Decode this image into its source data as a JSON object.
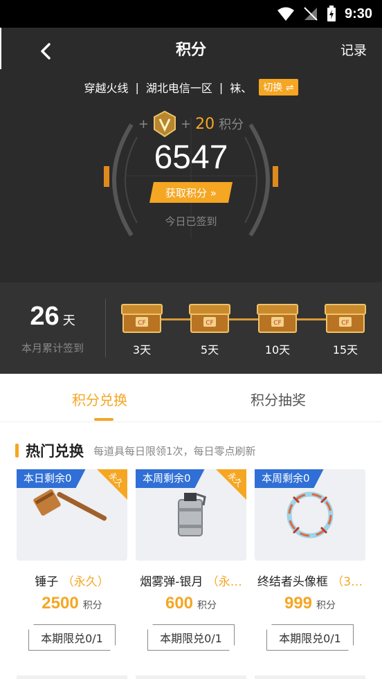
{
  "status_bar": {
    "time": "9:30"
  },
  "header": {
    "title": "积分",
    "records_label": "记录"
  },
  "account": {
    "game": "穿越火线",
    "server": "湖北电信一区",
    "role": "袜、",
    "switch_label": "切换 ⇌"
  },
  "bonus": {
    "plus1": "+",
    "plus2": "+",
    "amount": "20",
    "unit": "积分"
  },
  "points": {
    "value": "6547"
  },
  "get_points_label": "获取积分 »",
  "signed_status": "今日已签到",
  "month_sign": {
    "days": "26",
    "unit": "天",
    "label": "本月累计签到"
  },
  "chests": [
    {
      "label": "3天"
    },
    {
      "label": "5天"
    },
    {
      "label": "10天"
    },
    {
      "label": "15天"
    }
  ],
  "tabs": [
    {
      "label": "积分兑换",
      "active": true
    },
    {
      "label": "积分抽奖",
      "active": false
    }
  ],
  "section": {
    "title": "热门兑换",
    "note": "每道具每日限领1次，每日零点刷新"
  },
  "items": [
    {
      "tag": "本日剩余0",
      "corner": "永久",
      "name": "锤子",
      "duration": "（永久）",
      "price": "2500",
      "price_unit": "积分",
      "limit": "本期限兑0/1",
      "icon": "hammer-icon"
    },
    {
      "tag": "本周剩余0",
      "corner": "永久",
      "name": "烟雾弹-银月",
      "duration": "（永…",
      "price": "600",
      "price_unit": "积分",
      "limit": "本期限兑0/1",
      "icon": "smoke-grenade-icon"
    },
    {
      "tag": "本周剩余0",
      "corner": "",
      "name": "终结者头像框",
      "duration": "（3…",
      "price": "999",
      "price_unit": "积分",
      "limit": "本期限兑0/1",
      "icon": "avatar-frame-icon"
    }
  ],
  "colors": {
    "accent": "#f5a623",
    "tag_blue": "#2f6fd6",
    "dark_bg": "#2b2b2b"
  }
}
